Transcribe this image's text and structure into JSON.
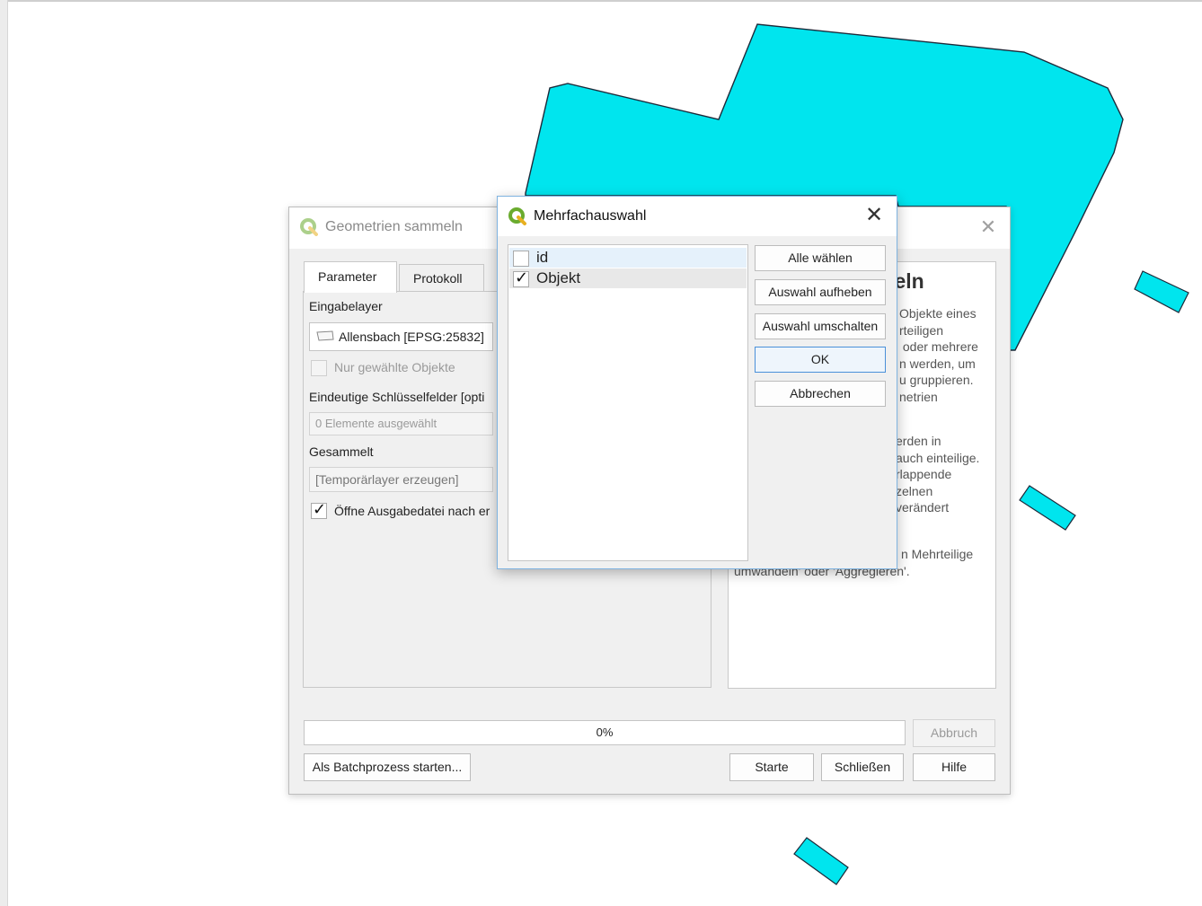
{
  "main_dialog": {
    "title": "Geometrien sammeln",
    "tabs": [
      "Parameter",
      "Protokoll"
    ],
    "input_layer": {
      "label": "Eingabelayer",
      "value": "Allensbach [EPSG:25832]"
    },
    "only_selected": {
      "label": "Nur gewählte Objekte",
      "checked": false
    },
    "key_fields": {
      "label": "Eindeutige Schlüsselfelder [opti",
      "value": "0 Elemente ausgewählt"
    },
    "collected": {
      "label": "Gesammelt",
      "value": "[Temporärlayer erzeugen]"
    },
    "open_output": {
      "label": "Öffne Ausgabedatei nach er",
      "checked": true
    },
    "help": {
      "title": "nmeln",
      "lines_a": [
        "Objekte eines",
        "rteiligen",
        " oder mehrere",
        "n werden, um",
        "u gruppieren.",
        "netrien"
      ],
      "lines_b": [
        "erden in",
        "auch einteilige.",
        "rlappende",
        "zelnen",
        "verändert"
      ],
      "lines_c": [
        "n Mehrteilige",
        "umwandeln' oder 'Aggregieren'."
      ]
    },
    "progress": {
      "text": "0%",
      "value": 0
    },
    "buttons": {
      "abort": "Abbruch",
      "batch": "Als Batchprozess starten...",
      "start": "Starte",
      "close": "Schließen",
      "help": "Hilfe"
    }
  },
  "modal": {
    "title": "Mehrfachauswahl",
    "items": [
      {
        "label": "id",
        "checked": false
      },
      {
        "label": "Objekt",
        "checked": true
      }
    ],
    "buttons": {
      "select_all": "Alle wählen",
      "clear": "Auswahl aufheben",
      "toggle": "Auswahl umschalten",
      "ok": "OK",
      "cancel": "Abbrechen"
    }
  },
  "map": {
    "polygon_fill": "#00e5ee",
    "polygon_stroke": "#1c2a3a"
  }
}
